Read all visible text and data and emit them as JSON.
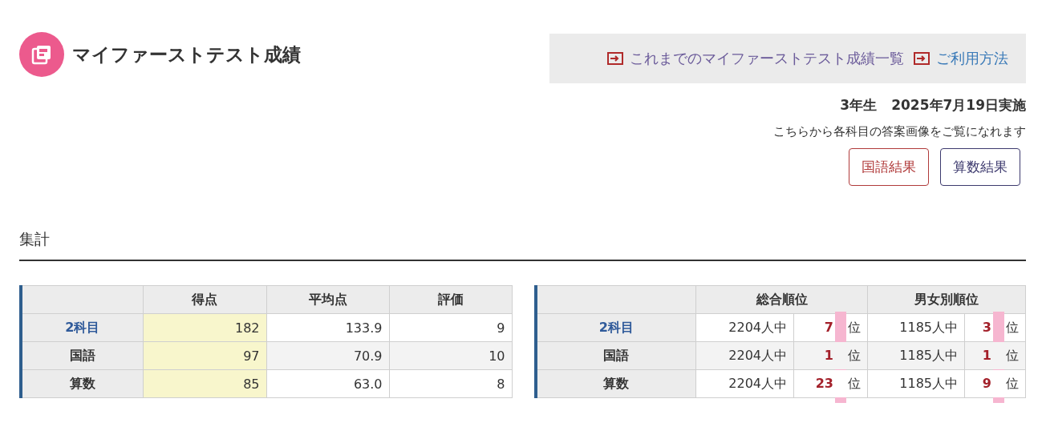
{
  "title": "マイファーストテスト成績",
  "links": [
    {
      "label": "これまでのマイファーストテスト成績一覧",
      "visited": true
    },
    {
      "label": "ご利用方法",
      "visited": false
    }
  ],
  "grade_label": "3年生",
  "exam_date": "2025年7月19日実施",
  "answer_note": "こちらから各科目の答案画像をご覧になれます",
  "result_buttons": [
    {
      "label": "国語結果",
      "color": "#b03a3a"
    },
    {
      "label": "算数結果",
      "color": "#3d3a6e"
    }
  ],
  "section_title": "集計",
  "score_table": {
    "columns": [
      "得点",
      "平均点",
      "評価"
    ],
    "rows": [
      {
        "subject": "2科目",
        "total": true,
        "score": "182",
        "average": "133.9",
        "grade": "9"
      },
      {
        "subject": "国語",
        "total": false,
        "score": "97",
        "average": "70.9",
        "grade": "10"
      },
      {
        "subject": "算数",
        "total": false,
        "score": "85",
        "average": "63.0",
        "grade": "8"
      }
    ]
  },
  "rank_table": {
    "columns": [
      "総合順位",
      "男女別順位"
    ],
    "masked": true,
    "rows": [
      {
        "subject": "2科目",
        "total": true,
        "overall_count": "2204人中",
        "overall_rank": "7",
        "overall_unit": "位",
        "gender_count": "1185人中",
        "gender_rank": "3",
        "gender_unit": "位"
      },
      {
        "subject": "国語",
        "total": false,
        "overall_count": "2204人中",
        "overall_rank": "1",
        "overall_unit": "位",
        "gender_count": "1185人中",
        "gender_rank": "1",
        "gender_unit": "位"
      },
      {
        "subject": "算数",
        "total": false,
        "overall_count": "2204人中",
        "overall_rank": "23",
        "overall_unit": "位",
        "gender_count": "1185人中",
        "gender_rank": "9",
        "gender_unit": "位"
      }
    ]
  }
}
